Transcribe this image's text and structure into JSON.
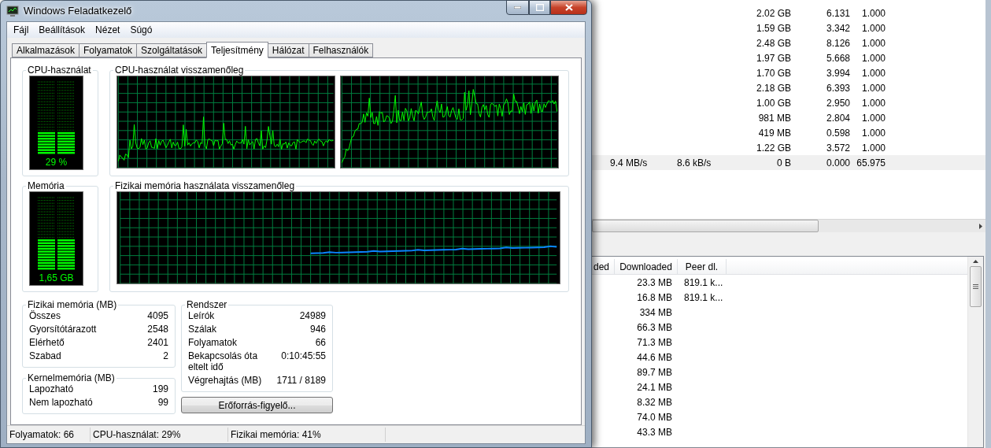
{
  "window": {
    "title": "Windows Feladatkezelő",
    "menu": [
      "Fájl",
      "Beállítások",
      "Nézet",
      "Súgó"
    ],
    "tabs": [
      {
        "label": "Alkalmazások",
        "selected": false
      },
      {
        "label": "Folyamatok",
        "selected": false
      },
      {
        "label": "Szolgáltatások",
        "selected": false
      },
      {
        "label": "Teljesítmény",
        "selected": true
      },
      {
        "label": "Hálózat",
        "selected": false
      },
      {
        "label": "Felhasználók",
        "selected": false
      }
    ],
    "performance": {
      "cpu_meter": {
        "title": "CPU-használat",
        "level": 0.29,
        "reading": "29 %"
      },
      "cpu_history": {
        "title": "CPU-használat visszamenőleg"
      },
      "memory_meter": {
        "title": "Memória",
        "level": 0.41,
        "reading": "1,65 GB"
      },
      "memory_history": {
        "title": "Fizikai memória használata visszamenőleg"
      },
      "physical_memory": {
        "title": "Fizikai memória (MB)",
        "rows": [
          {
            "label": "Összes",
            "value": "4095"
          },
          {
            "label": "Gyorsítótárazott",
            "value": "2548"
          },
          {
            "label": "Elérhető",
            "value": "2401"
          },
          {
            "label": "Szabad",
            "value": "2"
          }
        ]
      },
      "kernel_memory": {
        "title": "Kernelmemória (MB)",
        "rows": [
          {
            "label": "Lapozható",
            "value": "199"
          },
          {
            "label": "Nem lapozható",
            "value": "99"
          }
        ]
      },
      "system": {
        "title": "Rendszer",
        "rows": [
          {
            "label": "Leírók",
            "value": "24989"
          },
          {
            "label": "Szálak",
            "value": "946"
          },
          {
            "label": "Folyamatok",
            "value": "66"
          },
          {
            "label": "Bekapcsolás óta eltelt idő",
            "value": "0:10:45:55"
          },
          {
            "label": "Végrehajtás (MB)",
            "value": "1711 / 8189"
          }
        ]
      },
      "resource_monitor_button": "Erőforrás-figyelő..."
    },
    "status_bar": [
      "Folyamatok: 66",
      "CPU-használat: 29%",
      "Fizikai memória: 41%"
    ]
  },
  "background_app": {
    "top_table": {
      "rows": [
        {
          "column_3": "2.02 GB",
          "column_4": "6.131",
          "column_5": "1.000",
          "selected": false
        },
        {
          "column_3": "1.59 GB",
          "column_4": "3.342",
          "column_5": "1.000",
          "selected": false
        },
        {
          "column_3": "2.48 GB",
          "column_4": "8.126",
          "column_5": "1.000",
          "selected": false
        },
        {
          "column_3": "1.97 GB",
          "column_4": "5.668",
          "column_5": "1.000",
          "selected": false
        },
        {
          "column_3": "1.70 GB",
          "column_4": "3.994",
          "column_5": "1.000",
          "selected": false
        },
        {
          "column_3": "2.18 GB",
          "column_4": "6.393",
          "column_5": "1.000",
          "selected": false
        },
        {
          "column_3": "1.00 GB",
          "column_4": "2.950",
          "column_5": "1.000",
          "selected": false
        },
        {
          "column_3": "981 MB",
          "column_4": "2.804",
          "column_5": "1.000",
          "selected": false
        },
        {
          "column_3": "419 MB",
          "column_4": "0.598",
          "column_5": "1.000",
          "selected": false
        },
        {
          "column_3": "1.22 GB",
          "column_4": "3.572",
          "column_5": "1.000",
          "selected": false
        },
        {
          "column_1": "9.4 MB/s",
          "column_2": "8.6 kB/s",
          "column_3": "0 B",
          "column_4": "0.000",
          "column_5": "65.975",
          "selected": true
        }
      ]
    },
    "bottom_table": {
      "columns": [
        "ded",
        "Downloaded",
        "Peer dl."
      ],
      "rows": [
        {
          "column_2": "23.3 MB",
          "column_3": "819.1 k..."
        },
        {
          "column_2": "16.8 MB",
          "column_3": "819.1 k..."
        },
        {
          "column_2": "334 MB"
        },
        {
          "column_2": "66.3 MB"
        },
        {
          "column_2": "71.3 MB"
        },
        {
          "column_2": "44.6 MB"
        },
        {
          "column_2": "89.7 MB"
        },
        {
          "column_2": "24.1 MB"
        },
        {
          "column_2": "8.32 MB"
        },
        {
          "column_2": "74.0 MB"
        },
        {
          "column_2": "43.3 MB"
        }
      ]
    }
  }
}
